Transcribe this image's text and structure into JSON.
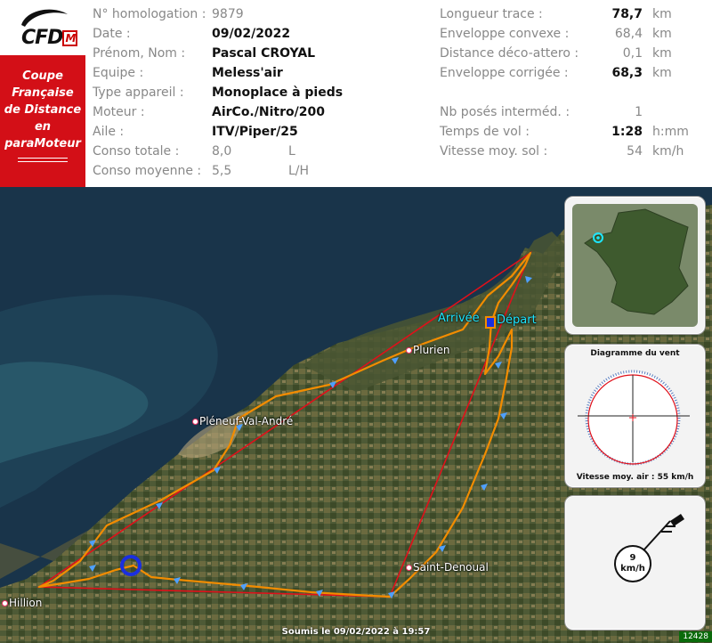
{
  "logo": {
    "text": "CFD",
    "box": "M"
  },
  "coupe": {
    "lines": [
      "Coupe",
      "Française",
      "de Distance",
      "en",
      "paraMoteur"
    ]
  },
  "left_fields": [
    {
      "label": "N° homologation :",
      "value": "9879",
      "bold": false,
      "unit": ""
    },
    {
      "label": "Date :",
      "value": "09/02/2022",
      "bold": true,
      "unit": ""
    },
    {
      "label": "Prénom, Nom :",
      "value": "Pascal CROYAL",
      "bold": true,
      "unit": ""
    },
    {
      "label": "Equipe :",
      "value": "Meless'air",
      "bold": true,
      "unit": ""
    },
    {
      "label": "Type appareil :",
      "value": "Monoplace à pieds",
      "bold": true,
      "unit": ""
    },
    {
      "label": "Moteur :",
      "value": "AirCo./Nitro/200",
      "bold": true,
      "unit": ""
    },
    {
      "label": "Aile :",
      "value": "ITV/Piper/25",
      "bold": true,
      "unit": ""
    },
    {
      "label": "Conso totale :",
      "value": "8,0",
      "bold": false,
      "unit": "L"
    },
    {
      "label": "Conso moyenne :",
      "value": "5,5",
      "bold": false,
      "unit": "L/H"
    }
  ],
  "right_fields": [
    {
      "label": "Longueur trace :",
      "value": "78,7",
      "bold": true,
      "unit": "km"
    },
    {
      "label": "Enveloppe convexe :",
      "value": "68,4",
      "bold": false,
      "unit": "km"
    },
    {
      "label": "Distance déco-attero :",
      "value": "0,1",
      "bold": false,
      "unit": "km"
    },
    {
      "label": "Enveloppe corrigée :",
      "value": "68,3",
      "bold": true,
      "unit": "km"
    },
    {
      "label": "Nb posés interméd. :",
      "value": "1",
      "bold": false,
      "unit": ""
    },
    {
      "label": "Temps de vol :",
      "value": "1:28",
      "bold": true,
      "unit": "h:mm"
    },
    {
      "label": "Vitesse moy. sol :",
      "value": "54",
      "bold": false,
      "unit": "km/h"
    }
  ],
  "map": {
    "places": {
      "arrivee": "Arrivée",
      "depart": "Départ",
      "plurien": "Plurien",
      "pleneuf": "Pléneuf-Val-André",
      "saint_denoual": "Saint-Denoual",
      "hillion": "Hillion"
    }
  },
  "wind_panel": {
    "title": "Diagramme du vent",
    "caption": "Vitesse moy. air : 55 km/h"
  },
  "wind_gauge": {
    "speed": "9",
    "unit": "km/h"
  },
  "footer": {
    "submitted": "Soumis le 09/02/2022 à 19:57",
    "badge": "12428"
  },
  "colors": {
    "red_brand": "#d30f17",
    "track": "#f28c00",
    "hull": "#e0101a",
    "cyan": "#1de6ff"
  }
}
